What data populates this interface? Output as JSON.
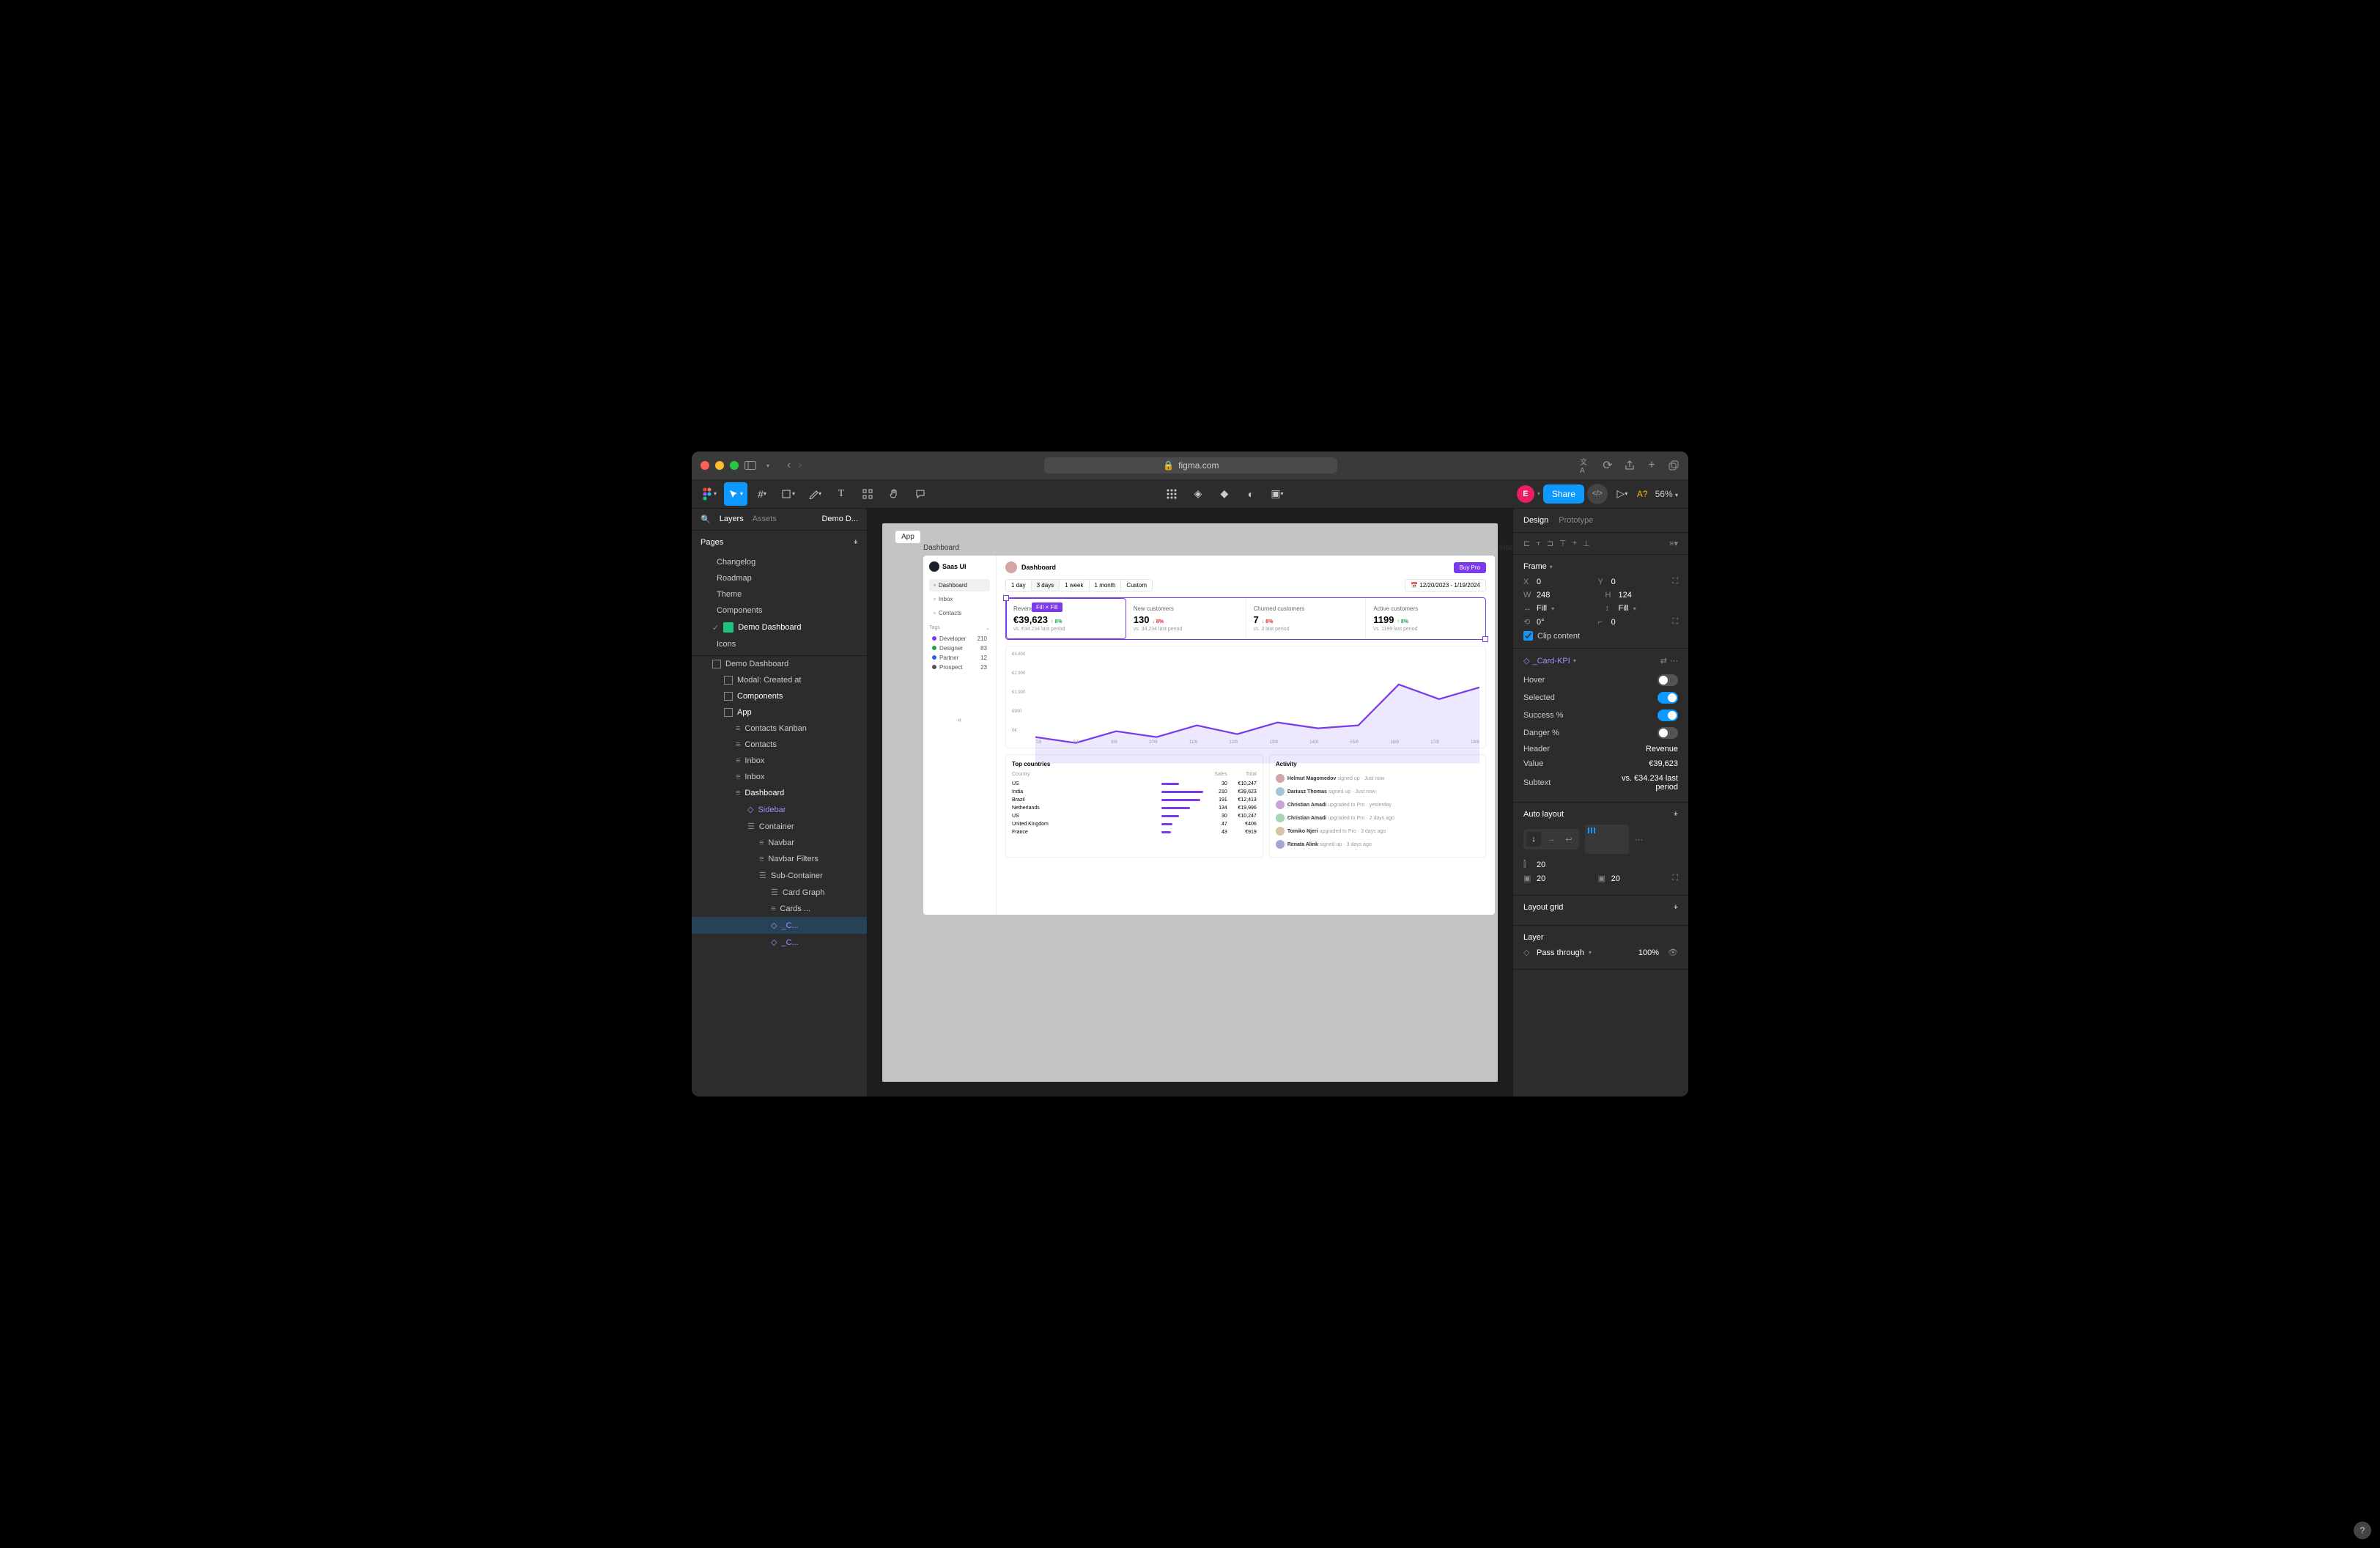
{
  "browser": {
    "url": "figma.com",
    "lock_icon": "lock-icon"
  },
  "figma_toolbar": {
    "share_label": "Share",
    "ai_label": "A?",
    "zoom": "56%",
    "avatar_initial": "E"
  },
  "left_panel": {
    "tabs": [
      "Layers",
      "Assets"
    ],
    "file_name": "Demo D...",
    "pages_label": "Pages",
    "pages": [
      "Changelog",
      "Roadmap",
      "Theme",
      "Components",
      "Demo Dashboard",
      "Icons"
    ],
    "layers_root": "Demo Dashboard",
    "layers": [
      {
        "label": "Modal: Created at",
        "indent": 2,
        "icon": "frame"
      },
      {
        "label": "Components",
        "indent": 2,
        "icon": "frame",
        "bold": true
      },
      {
        "label": "App",
        "indent": 2,
        "icon": "frame",
        "bold": true
      },
      {
        "label": "Contacts Kanban",
        "indent": 3,
        "icon": "bars"
      },
      {
        "label": "Contacts",
        "indent": 3,
        "icon": "bars"
      },
      {
        "label": "Inbox",
        "indent": 3,
        "icon": "bars"
      },
      {
        "label": "Inbox",
        "indent": 3,
        "icon": "bars"
      },
      {
        "label": "Dashboard",
        "indent": 3,
        "icon": "bars",
        "bold": true
      },
      {
        "label": "Sidebar",
        "indent": 4,
        "icon": "diamond",
        "highlighted": true
      },
      {
        "label": "Container",
        "indent": 4,
        "icon": "stack"
      },
      {
        "label": "Navbar",
        "indent": 5,
        "icon": "bars"
      },
      {
        "label": "Navbar Filters",
        "indent": 5,
        "icon": "bars"
      },
      {
        "label": "Sub-Container",
        "indent": 5,
        "icon": "stack"
      },
      {
        "label": "Card Graph",
        "indent": 6,
        "icon": "stack"
      },
      {
        "label": "Cards ...",
        "indent": 6,
        "icon": "bars"
      },
      {
        "label": "_C...",
        "indent": 6,
        "icon": "diamond",
        "selected": true,
        "highlighted": true
      },
      {
        "label": "_C...",
        "indent": 6,
        "icon": "diamond",
        "highlighted": true
      }
    ]
  },
  "canvas": {
    "frame_label": "App",
    "artboard_title": "Dashboard",
    "inbox_label": "Inbox",
    "fill_badge": "Fill × Fill"
  },
  "dashboard": {
    "logo": "Saas UI",
    "title": "Dashboard",
    "buy_pro": "Buy Pro",
    "nav": [
      {
        "label": "Dashboard",
        "active": true
      },
      {
        "label": "Inbox"
      },
      {
        "label": "Contacts"
      }
    ],
    "tags_label": "Tags",
    "tags": [
      {
        "label": "Developer",
        "count": 210,
        "color": "#7c3aed"
      },
      {
        "label": "Designer",
        "count": 83,
        "color": "#16a34a"
      },
      {
        "label": "Partner",
        "count": 12,
        "color": "#2563eb"
      },
      {
        "label": "Prospect",
        "count": 23,
        "color": "#555"
      }
    ],
    "filters": [
      "1 day",
      "3 days",
      "1 week",
      "1 month",
      "Custom"
    ],
    "filter_active": "3 days",
    "date_range": "12/20/2023 - 1/19/2024",
    "kpis": [
      {
        "label": "Revenue",
        "value": "€39,623",
        "delta": "8%",
        "dir": "up",
        "sub": "vs. €34.234 last period",
        "selected": true
      },
      {
        "label": "New customers",
        "value": "130",
        "delta": "8%",
        "dir": "down",
        "sub": "vs. 34,234 last period"
      },
      {
        "label": "Churned customers",
        "value": "7",
        "delta": "8%",
        "dir": "down",
        "sub": "vs. 3 last period"
      },
      {
        "label": "Active customers",
        "value": "1199",
        "delta": "8%",
        "dir": "up",
        "sub": "vs. 1199 last period"
      }
    ],
    "countries_title": "Top countries",
    "countries_headers": [
      "Country",
      "Sales",
      "Total"
    ],
    "countries": [
      {
        "name": "US",
        "sales": 30,
        "total": "€10,247",
        "bar": 40
      },
      {
        "name": "India",
        "sales": 210,
        "total": "€39,623",
        "bar": 95
      },
      {
        "name": "Brazil",
        "sales": 191,
        "total": "€12,413",
        "bar": 88
      },
      {
        "name": "Netherlands",
        "sales": 134,
        "total": "€19,996",
        "bar": 65
      },
      {
        "name": "US",
        "sales": 30,
        "total": "€10,247",
        "bar": 40
      },
      {
        "name": "United Kingdom",
        "sales": 47,
        "total": "€406",
        "bar": 25
      },
      {
        "name": "France",
        "sales": 43,
        "total": "€919",
        "bar": 22
      }
    ],
    "activity_title": "Activity",
    "activity": [
      {
        "name": "Helmut Magomedov",
        "action": "signed up",
        "time": "Just now"
      },
      {
        "name": "Dariusz Thomas",
        "action": "signed up",
        "time": "Just now"
      },
      {
        "name": "Christian Amadi",
        "action": "upgraded to Pro",
        "time": "yesterday"
      },
      {
        "name": "Christian Amadi",
        "action": "upgraded to Pro",
        "time": "2 days ago"
      },
      {
        "name": "Tomiko Njeri",
        "action": "upgraded to Pro",
        "time": "3 days ago"
      },
      {
        "name": "Renata Alink",
        "action": "signed up",
        "time": "3 days ago"
      }
    ]
  },
  "chart_data": {
    "type": "area",
    "title": "",
    "xlabel": "",
    "ylabel": "",
    "ylim": [
      0,
      3800
    ],
    "y_ticks": [
      "€3,800",
      "€2,900",
      "€1,900",
      "€900",
      "0€"
    ],
    "categories": [
      "7/8",
      "8/8",
      "9/8",
      "10/8",
      "11/8",
      "12/8",
      "13/8",
      "14/8",
      "15/8",
      "16/8",
      "17/8",
      "18/8"
    ],
    "values": [
      900,
      700,
      1100,
      900,
      1300,
      1000,
      1400,
      1200,
      1300,
      2700,
      2200,
      2600
    ]
  },
  "right_panel": {
    "tabs": [
      "Design",
      "Prototype"
    ],
    "frame_label": "Frame",
    "x": "0",
    "y": "0",
    "w": "248",
    "h": "124",
    "resize_h": "Fill",
    "resize_v": "Fill",
    "rotation": "0°",
    "corner": "0",
    "clip_content": "Clip content",
    "component_name": "_Card-KPI",
    "props": [
      {
        "label": "Hover",
        "type": "toggle",
        "on": false
      },
      {
        "label": "Selected",
        "type": "toggle",
        "on": true
      },
      {
        "label": "Success %",
        "type": "toggle",
        "on": true
      },
      {
        "label": "Danger %",
        "type": "toggle",
        "on": false
      },
      {
        "label": "Header",
        "type": "text",
        "value": "Revenue"
      },
      {
        "label": "Value",
        "type": "text",
        "value": "€39,623"
      },
      {
        "label": "Subtext",
        "type": "text",
        "value": "vs. €34.234 last period"
      }
    ],
    "auto_layout_label": "Auto layout",
    "gap_v": "20",
    "gap_h": "20",
    "layout_grid_label": "Layout grid",
    "layer_label": "Layer",
    "blend": "Pass through",
    "opacity": "100%"
  }
}
